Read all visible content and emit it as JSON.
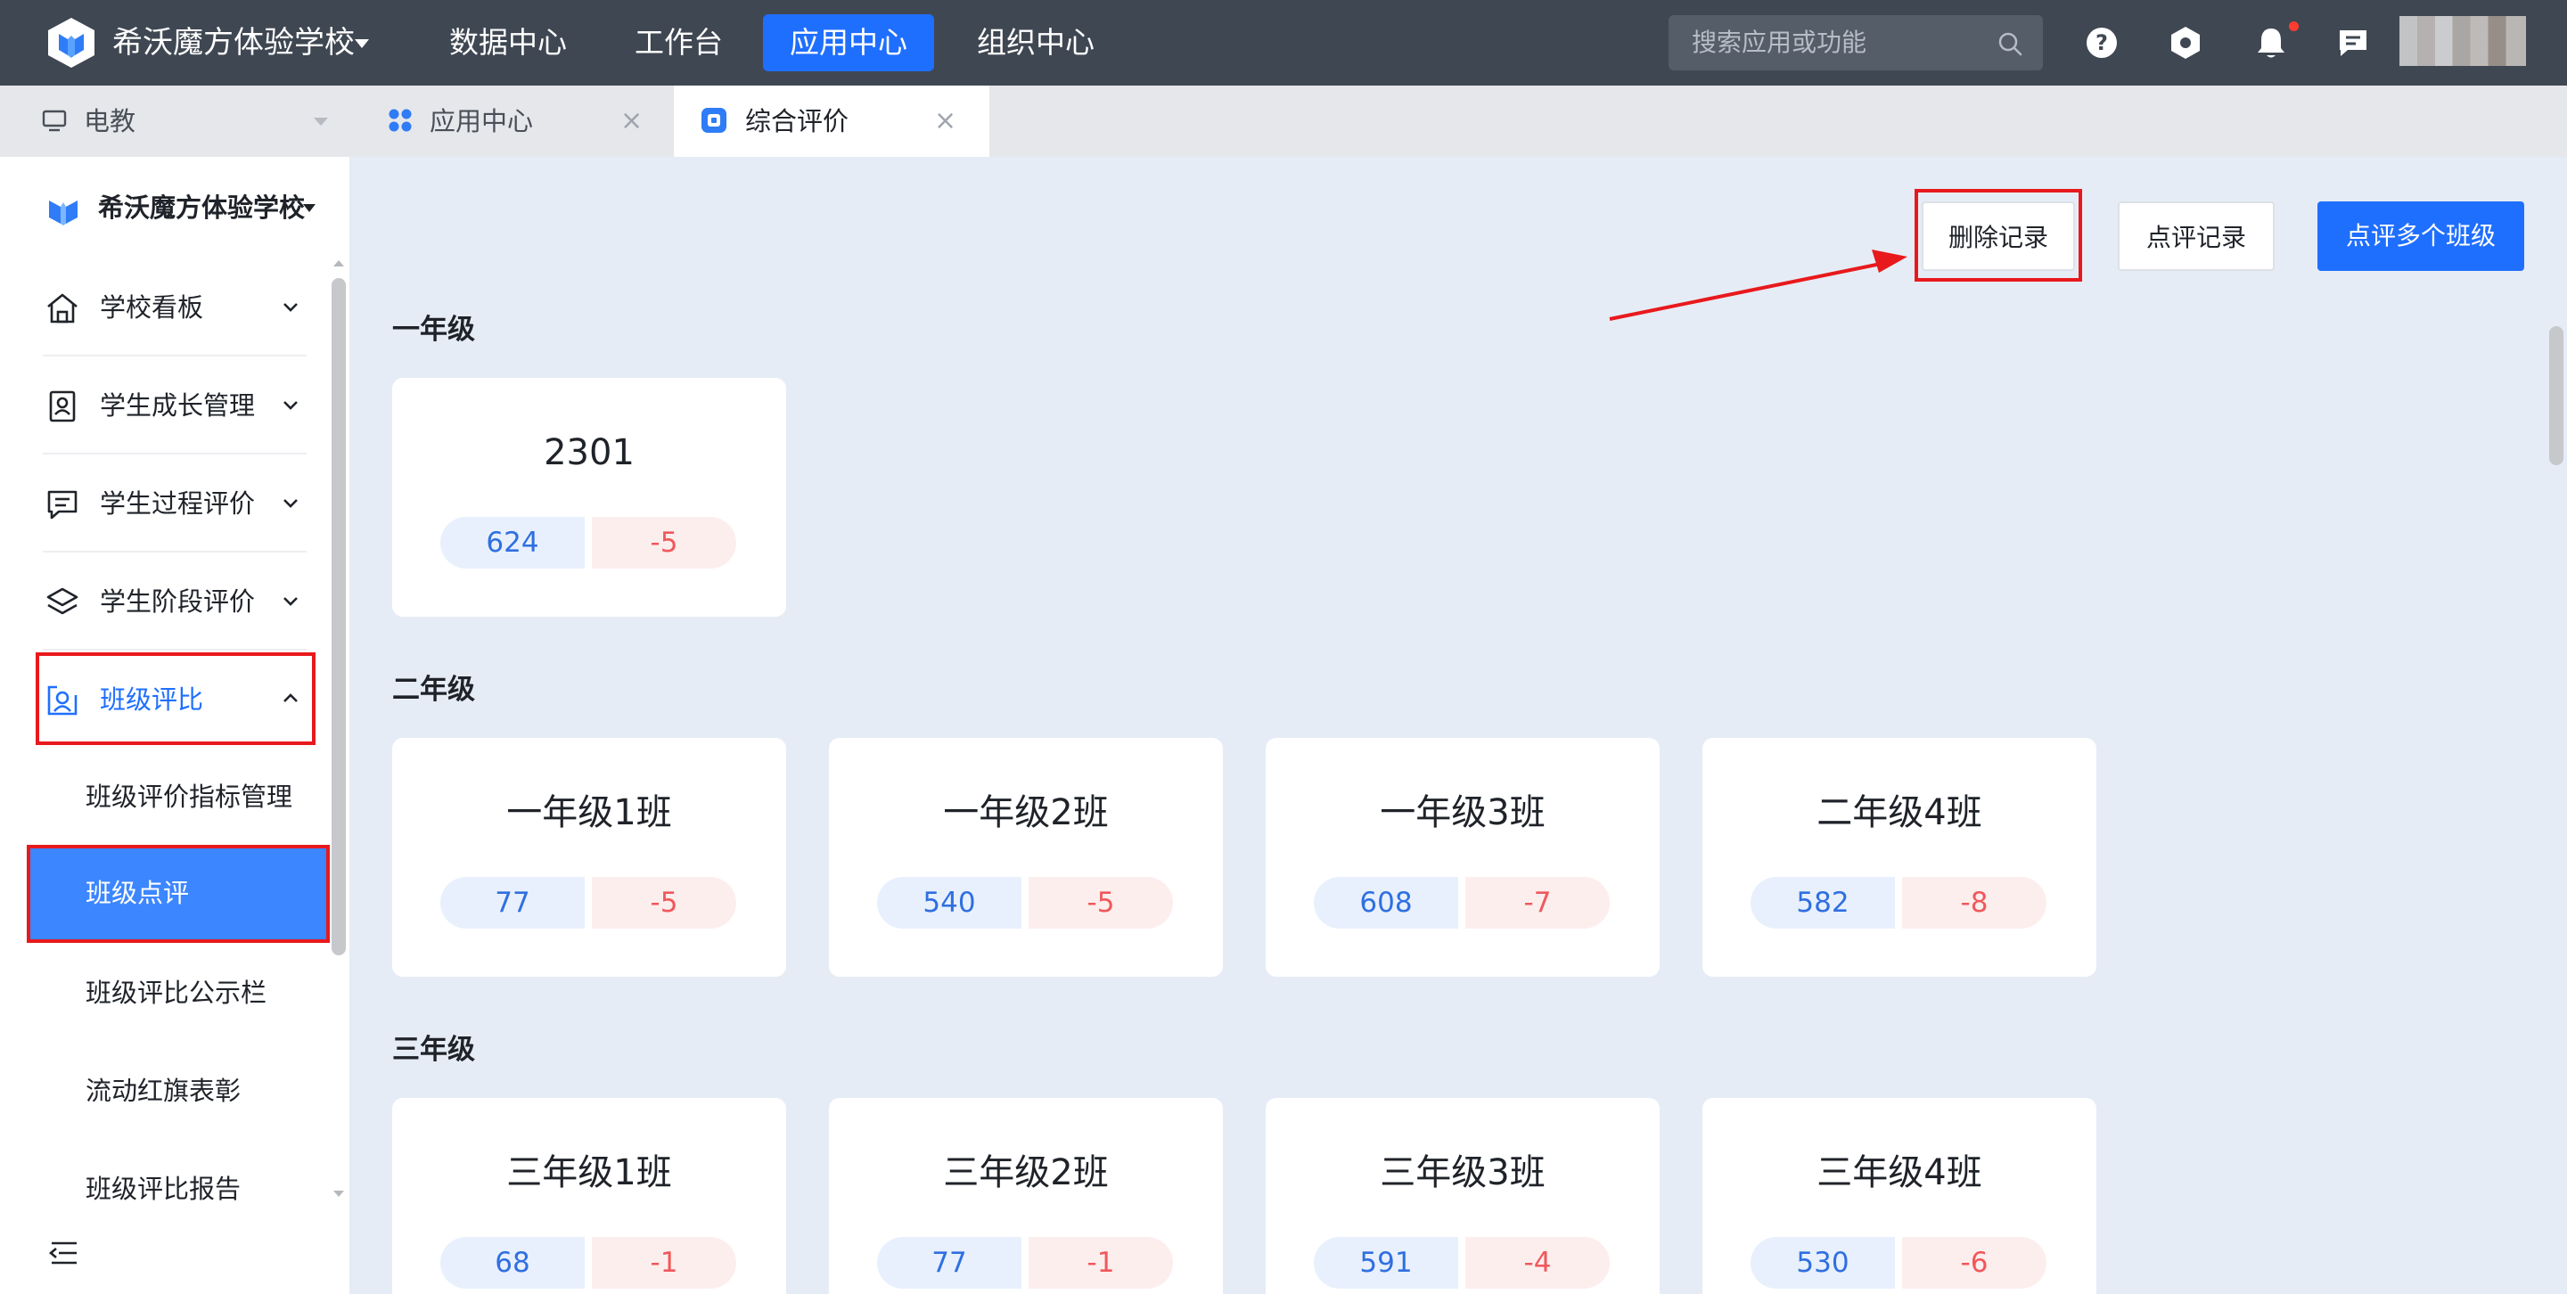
{
  "topbar": {
    "school": "希沃魔方体验学校",
    "nav": [
      "数据中心",
      "工作台",
      "应用中心",
      "组织中心"
    ],
    "active_nav": "应用中心",
    "search_placeholder": "搜索应用或功能"
  },
  "tabs": {
    "items": [
      {
        "label": "电教",
        "icon": "monitor-icon"
      },
      {
        "label": "应用中心",
        "icon": "apps-grid-icon"
      },
      {
        "label": "综合评价",
        "icon": "evaluation-app-icon"
      }
    ],
    "active": "综合评价"
  },
  "sidebar": {
    "school": "希沃魔方体验学校",
    "menu": [
      {
        "label": "学校看板",
        "icon": "school-home-icon"
      },
      {
        "label": "学生成长管理",
        "icon": "student-card-icon"
      },
      {
        "label": "学生过程评价",
        "icon": "chat-bubble-icon"
      },
      {
        "label": "学生阶段评价",
        "icon": "layers-icon"
      },
      {
        "label": "班级评比",
        "icon": "class-user-icon"
      }
    ],
    "submenu": [
      "班级评价指标管理",
      "班级点评",
      "班级评比公示栏",
      "流动红旗表彰",
      "班级评比报告"
    ],
    "active_submenu": "班级点评"
  },
  "toolbar": {
    "delete_records": "删除记录",
    "review_records": "点评记录",
    "review_multiple": "点评多个班级"
  },
  "grades": [
    {
      "title": "一年级",
      "classes": [
        {
          "name": "2301",
          "positive": "624",
          "negative": "-5"
        }
      ]
    },
    {
      "title": "二年级",
      "classes": [
        {
          "name": "一年级1班",
          "positive": "77",
          "negative": "-5"
        },
        {
          "name": "一年级2班",
          "positive": "540",
          "negative": "-5"
        },
        {
          "name": "一年级3班",
          "positive": "608",
          "negative": "-7"
        },
        {
          "name": "二年级4班",
          "positive": "582",
          "negative": "-8"
        }
      ]
    },
    {
      "title": "三年级",
      "classes": [
        {
          "name": "三年级1班",
          "positive": "68",
          "negative": "-1"
        },
        {
          "name": "三年级2班",
          "positive": "77",
          "negative": "-1"
        },
        {
          "name": "三年级3班",
          "positive": "591",
          "negative": "-4"
        },
        {
          "name": "三年级4班",
          "positive": "530",
          "negative": "-6"
        }
      ]
    }
  ],
  "colors": {
    "accent": "#1f6fff",
    "topbar": "#3f4752",
    "annotation_red": "#e8191c",
    "positive_text": "#2f6fe0",
    "negative_text": "#f0585b"
  }
}
